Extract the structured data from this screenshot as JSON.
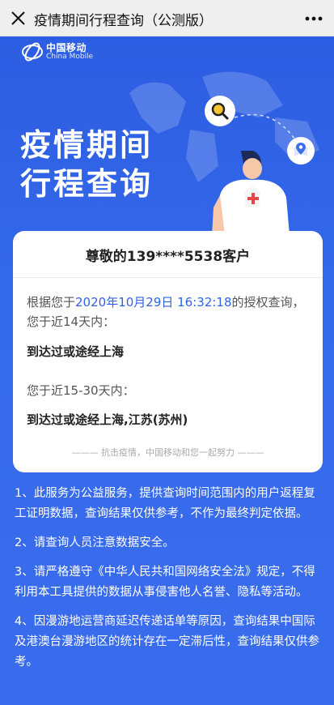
{
  "header": {
    "title": "疫情期间行程查询（公测版）"
  },
  "brand": {
    "name_cn": "中国移动",
    "name_en": "China Mobile"
  },
  "hero": {
    "title_line1": "疫情期间",
    "title_line2": "行程查询"
  },
  "card": {
    "greeting": "尊敬的139****5538客户",
    "intro_prefix": "根据您于",
    "auth_time": "2020年10月29日 16:32:18",
    "intro_suffix": "的授权查询，您于近14天内：",
    "destination_14": "到达过或途经上海",
    "period_2": "您于近15-30天内：",
    "destination_30": "到达过或途经上海,江苏(苏州)",
    "slogan": "———   抗击疫情，中国移动和您一起努力   ———"
  },
  "notes": [
    "1、此服务为公益服务，提供查询时间范围内的用户返程复工证明数据，查询结果仅供参考，不作为最终判定依据。",
    "2、请查询人员注意数据安全。",
    "3、请严格遵守《中华人民共和国网络安全法》规定，不得利用本工具提供的数据从事侵害他人名誉、隐私等活动。",
    "4、因漫游地运营商延迟传递话单等原因，查询结果中国际及港澳台漫游地区的统计存在一定滞后性，查询结果仅供参考。"
  ],
  "icons": {
    "close": "close-icon",
    "more": "more-icon",
    "search": "search-icon",
    "location": "location-pin-icon",
    "prev": "chevron-left-icon"
  },
  "colors": {
    "primary_blue": "#2f63e6",
    "accent_text": "#2f63e6"
  }
}
